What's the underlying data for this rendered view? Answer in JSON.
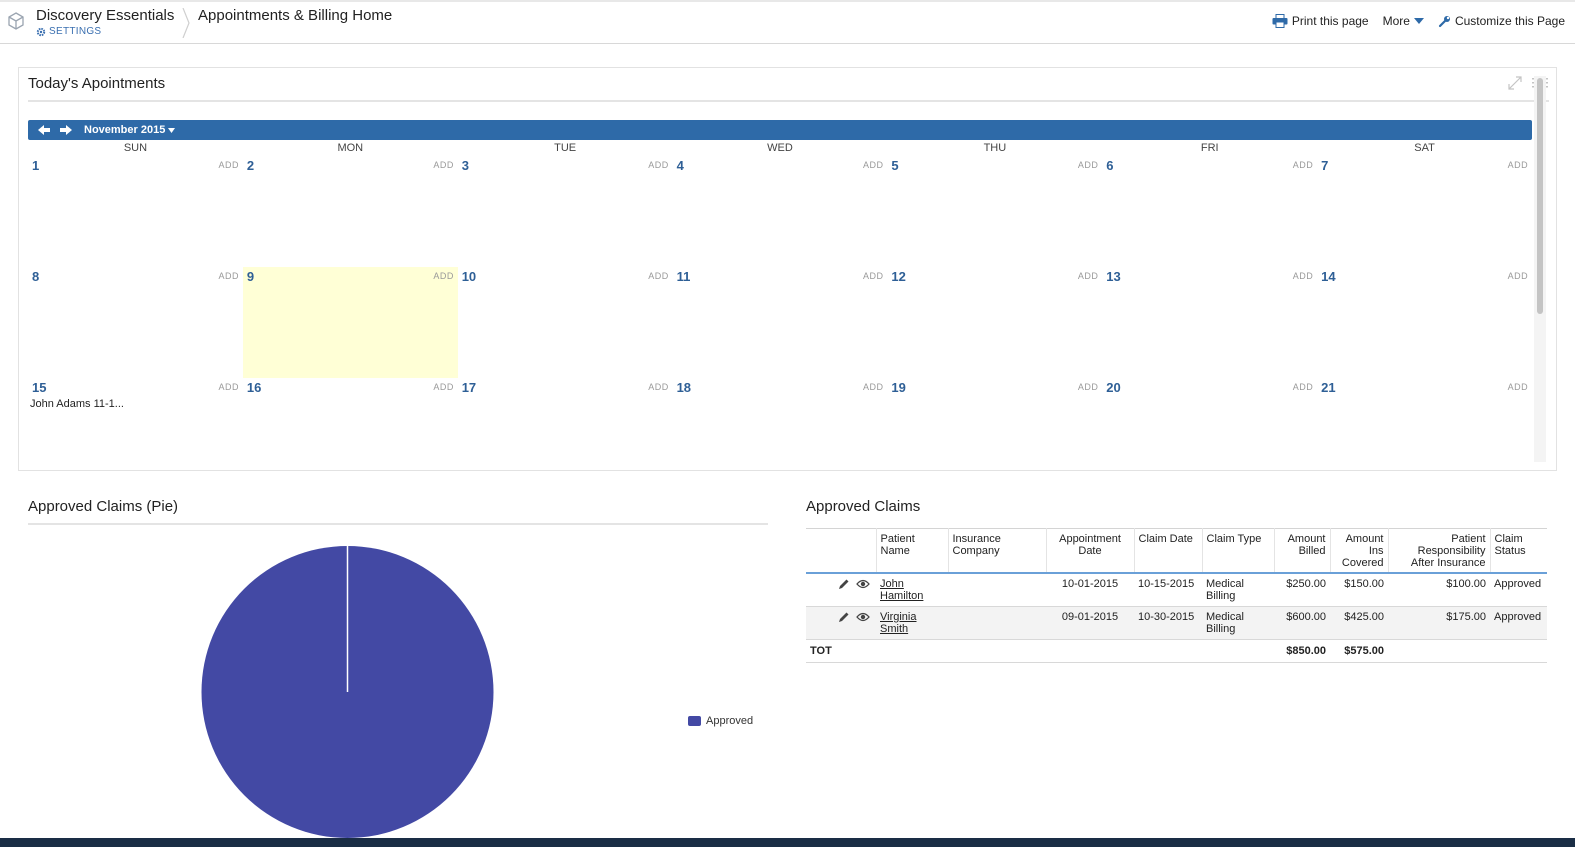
{
  "header": {
    "app_name": "Discovery Essentials",
    "settings_label": "SETTINGS",
    "page_title": "Appointments & Billing Home",
    "actions": {
      "print": "Print this page",
      "more": "More",
      "customize": "Customize this Page"
    }
  },
  "appointments": {
    "title": "Today's Apointments",
    "month_label": "November 2015",
    "day_headers": [
      "SUN",
      "MON",
      "TUE",
      "WED",
      "THU",
      "FRI",
      "SAT"
    ],
    "add_label": "ADD",
    "today": 9,
    "weeks": [
      [
        1,
        2,
        3,
        4,
        5,
        6,
        7
      ],
      [
        8,
        9,
        10,
        11,
        12,
        13,
        14
      ],
      [
        15,
        16,
        17,
        18,
        19,
        20,
        21
      ]
    ],
    "events": [
      {
        "day": 15,
        "text": "John Adams 11-1..."
      }
    ]
  },
  "pie": {
    "title": "Approved Claims (Pie)",
    "color": "#4349a4"
  },
  "chart_data": {
    "type": "pie",
    "categories": [
      "Approved"
    ],
    "values": [
      100
    ],
    "title": "Approved Claims (Pie)",
    "legend_placement": "right"
  },
  "claims": {
    "title": "Approved Claims",
    "columns": [
      "",
      "Patient Name",
      "Insurance Company",
      "Appointment Date",
      "Claim Date",
      "Claim Type",
      "Amount Billed",
      "Amount Ins Covered",
      "Patient Responsibility After Insurance",
      "Claim Status"
    ],
    "rows": [
      {
        "patient": "John Hamilton",
        "insurance": "",
        "appt_date": "10-01-2015",
        "claim_date": "10-15-2015",
        "claim_type": "Medical Billing",
        "billed": "$250.00",
        "covered": "$150.00",
        "responsibility": "$100.00",
        "status": "Approved"
      },
      {
        "patient": "Virginia Smith",
        "insurance": "",
        "appt_date": "09-01-2015",
        "claim_date": "10-30-2015",
        "claim_type": "Medical Billing",
        "billed": "$600.00",
        "covered": "$425.00",
        "responsibility": "$175.00",
        "status": "Approved"
      }
    ],
    "total": {
      "label": "TOT",
      "billed": "$850.00",
      "covered": "$575.00"
    }
  }
}
